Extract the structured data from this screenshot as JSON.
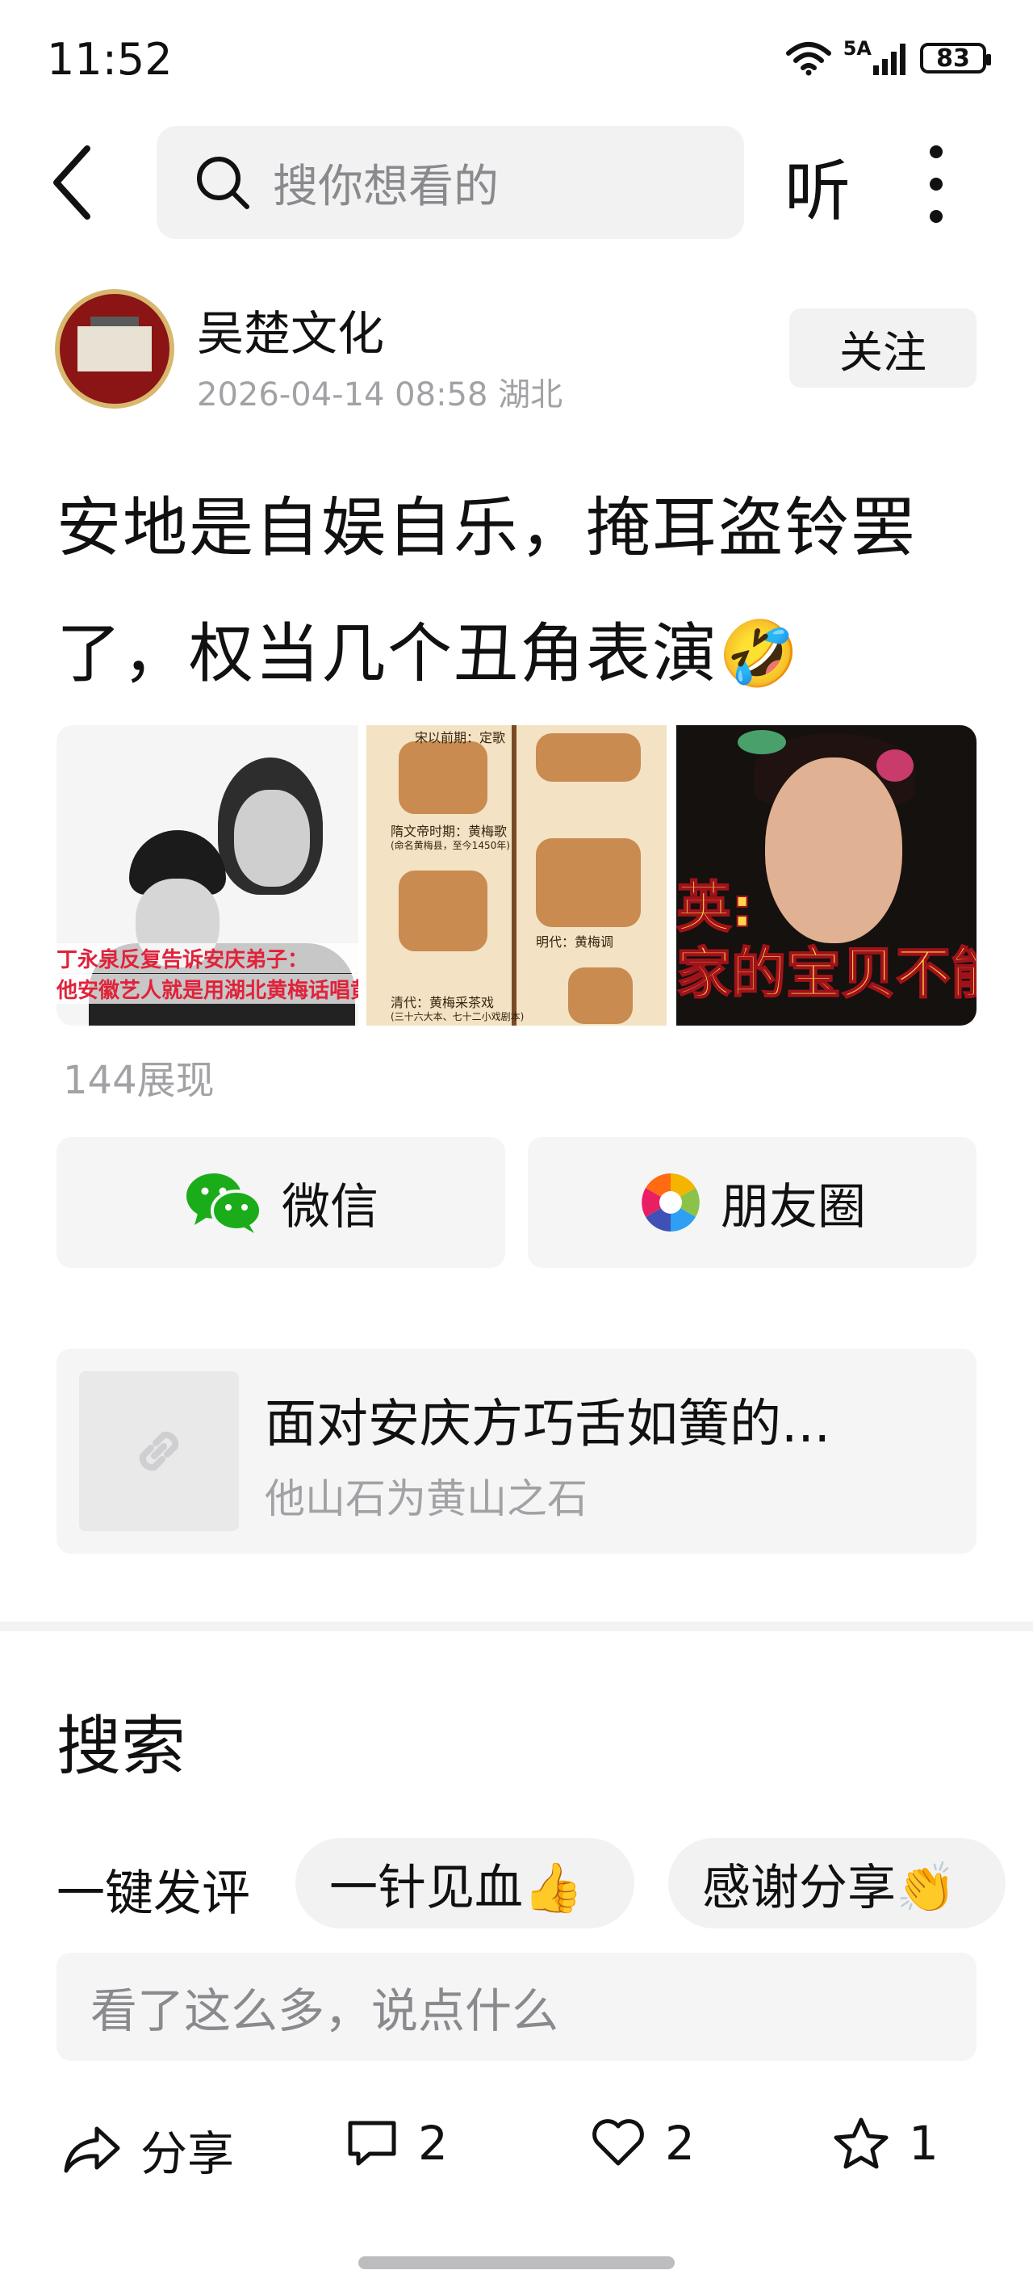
{
  "status_bar": {
    "time": "11:52",
    "network": "5A",
    "battery": "83",
    "icons": [
      "wifi-icon",
      "signal-icon",
      "battery-icon"
    ]
  },
  "nav": {
    "back_icon": "chevron-left-icon",
    "search_placeholder": "搜你想看的",
    "listen_label": "听",
    "more_icon": "more-vertical-icon"
  },
  "author": {
    "name": "吴楚文化",
    "meta": "2026-04-14 08:58 湖北",
    "follow_label": "关注"
  },
  "post": {
    "title": "安地是自娱自乐，掩耳盗铃罢了，权当几个丑角表演🤣",
    "images": [
      {
        "caption_line1": "丁永泉反复告诉安庆弟子：",
        "caption_line2": "他安徽艺人就是用湖北黄梅话唱黄"
      },
      {
        "labels": [
          "宋以前期：定歌",
          "隋文帝时期：黄梅歌",
          "(命名黄梅县，至今1450年)",
          "明代：黄梅调",
          "清代：黄梅采茶戏",
          "(三十六大本、七十二小戏剧本)"
        ]
      },
      {
        "caption_line1": "英:",
        "caption_line2": "家的宝贝不能丢"
      }
    ],
    "views": "144展现"
  },
  "share": {
    "wechat_label": "微信",
    "moments_label": "朋友圈"
  },
  "link_card": {
    "title": "面对安庆方巧舌如簧的...",
    "subtitle": "他山石为黄山之石"
  },
  "search_section": {
    "heading": "搜索"
  },
  "quick_comment": {
    "label": "一键发评",
    "chips": [
      "一针见血👍",
      "感谢分享👏"
    ]
  },
  "comment_input": {
    "placeholder": "看了这么多，说点什么"
  },
  "actions": {
    "share_label": "分享",
    "comment_count": "2",
    "like_count": "2",
    "favorite_count": "1"
  },
  "colors": {
    "wechat_green": "#1aad19",
    "muted_text": "#a2a2a6",
    "chip_bg": "#f2f2f3"
  }
}
